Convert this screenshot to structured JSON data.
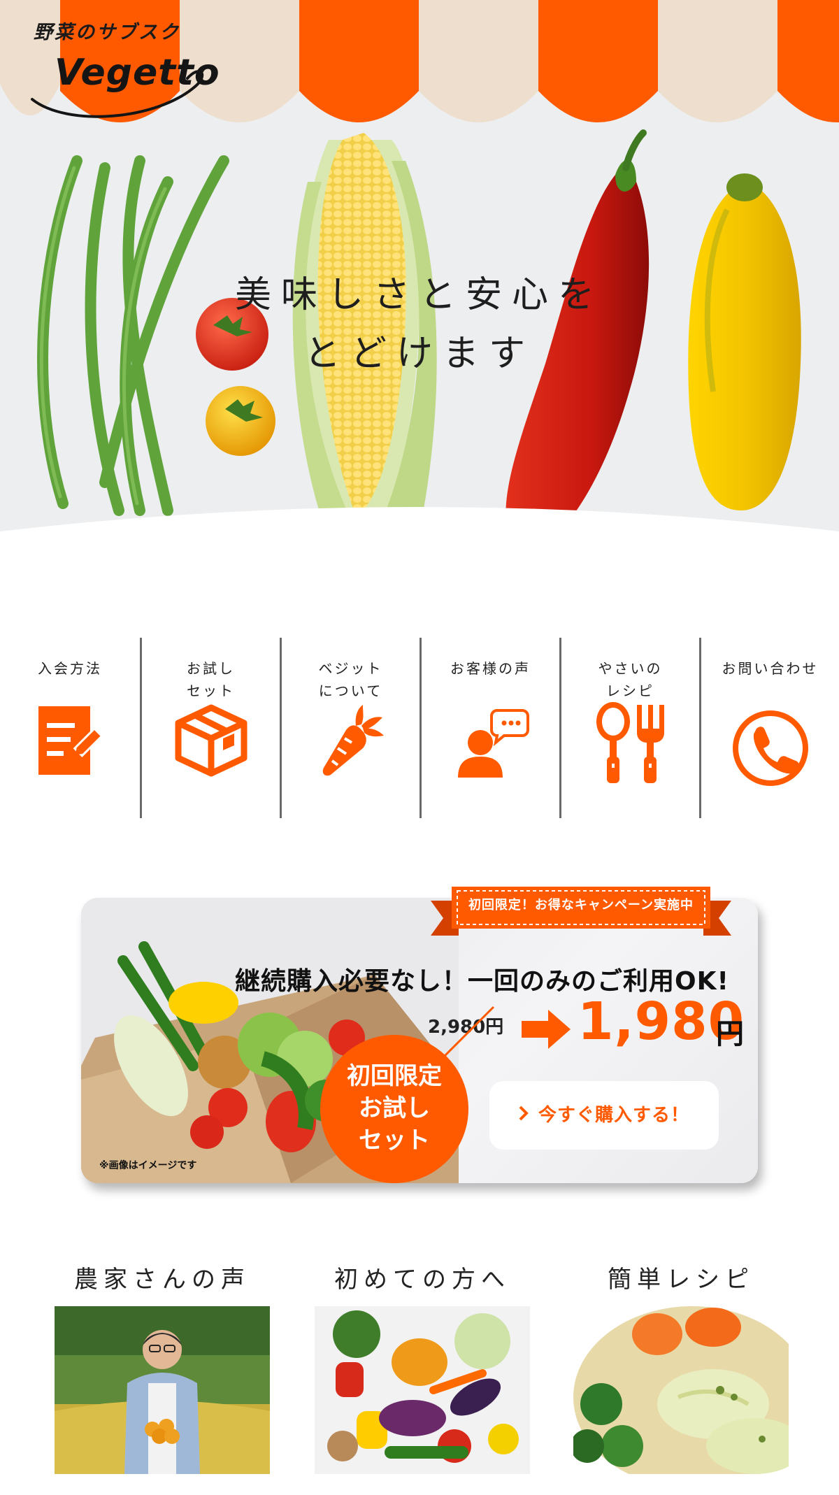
{
  "logo": {
    "tagline": "野菜のサブスク",
    "name": "Vegetto"
  },
  "hero": {
    "copy_line1": "美味しさと安心を",
    "copy_line2": "とどけます"
  },
  "nav": {
    "items": [
      {
        "label": "入会方法",
        "icon": "form-pencil-icon"
      },
      {
        "label": "お試し\nセット",
        "icon": "box-icon"
      },
      {
        "label": "ベジット\nについて",
        "icon": "carrot-icon"
      },
      {
        "label": "お客様の声",
        "icon": "customer-speech-icon"
      },
      {
        "label": "やさいの\nレシピ",
        "icon": "spoon-fork-icon"
      },
      {
        "label": "お問い合わせ",
        "icon": "phone-icon"
      }
    ]
  },
  "promo": {
    "ribbon": "初回限定！お得なキャンペーン実施中",
    "headline": "継続購入必要なし！一回のみのご利用OK!",
    "old_price": "2,980円",
    "new_price": "1,980",
    "yen": "円",
    "badge_line1": "初回限定",
    "badge_line2": "お試し",
    "badge_line3": "セット",
    "buy_label": "今すぐ購入する！",
    "note": "※画像はイメージです"
  },
  "cards": [
    {
      "title": "農家さんの声"
    },
    {
      "title": "初めての方へ"
    },
    {
      "title": "簡単レシピ"
    }
  ],
  "colors": {
    "accent": "#ff5a00",
    "awning_light": "#eedecd"
  }
}
